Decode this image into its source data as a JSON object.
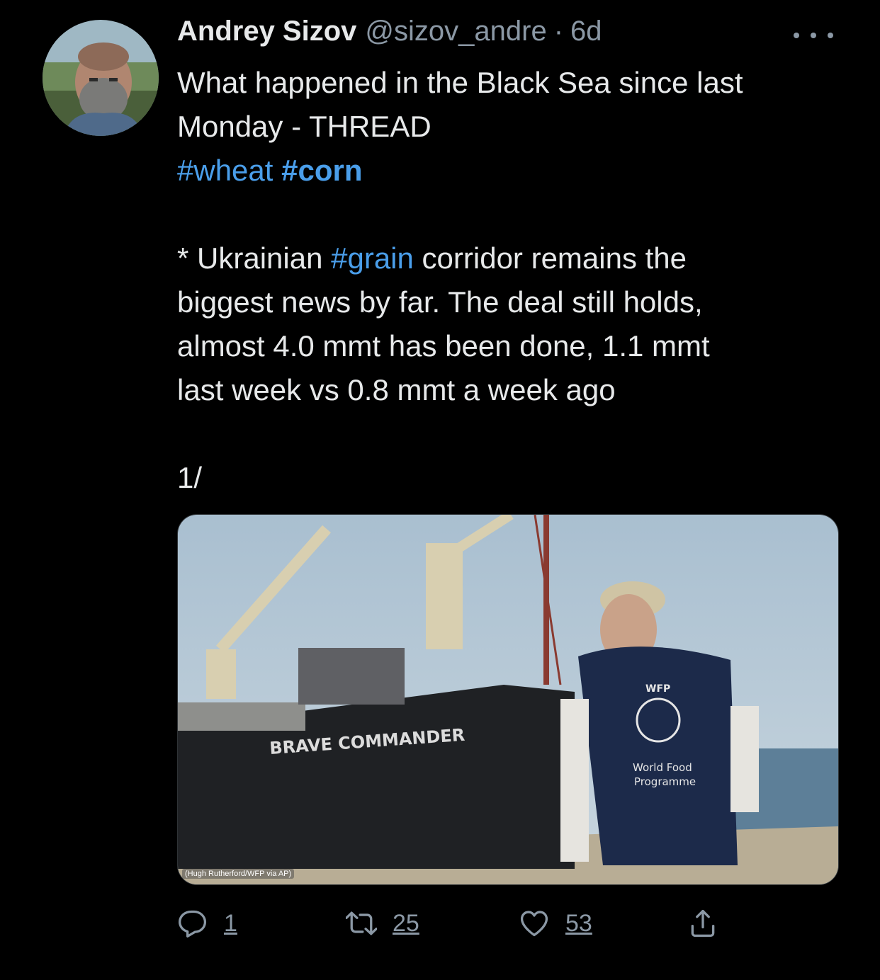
{
  "tweet": {
    "author": {
      "display_name": "Andrey Sizov",
      "handle": "@sizov_andre",
      "separator": "·",
      "time": "6d",
      "avatar_icon": "avatar-photo"
    },
    "more_icon": "more-horizontal-icon",
    "text": {
      "line1": "What happened in the Black Sea since last",
      "line2": "Monday - THREAD",
      "hashtag_wheat": "#wheat",
      "hashtag_corn": "#corn",
      "line4_prefix": "* Ukrainian ",
      "hashtag_grain": "#grain",
      "line4_suffix": " corridor remains the",
      "line5": "biggest news by far. The deal still holds,",
      "line6": "almost 4.0 mmt has been done, 1.1 mmt",
      "line7": "last week vs 0.8 mmt a week ago",
      "line8": "1/"
    },
    "media": {
      "ship_name": "BRAVE COMMANDER",
      "vest_label_top": "WFP",
      "vest_label_line1": "World Food",
      "vest_label_line2": "Programme",
      "credit": "(Hugh Rutherford/WFP via AP)"
    },
    "actions": {
      "replies": "1",
      "retweets": "25",
      "likes": "53"
    }
  },
  "colors": {
    "background": "#000000",
    "text": "#e7e9ea",
    "secondary": "#8b98a5",
    "hashtag": "#4a9eea"
  }
}
